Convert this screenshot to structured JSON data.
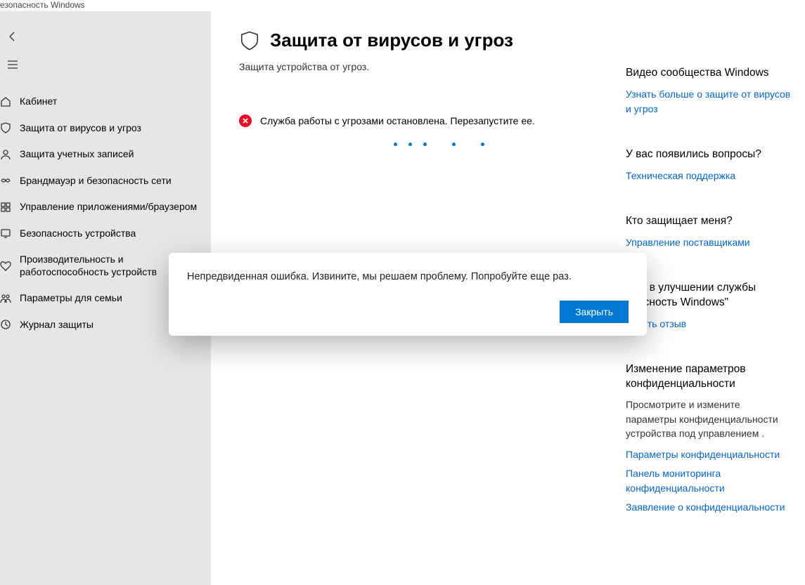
{
  "window": {
    "title_fragment": "езопасность Windows"
  },
  "sidebar": {
    "items": [
      {
        "label": "Кабинет"
      },
      {
        "label": "Защита от вирусов и угроз"
      },
      {
        "label": "Защита учетных записей"
      },
      {
        "label": "Брандмауэр и безопасность сети"
      },
      {
        "label": "Управление приложениями/браузером"
      },
      {
        "label": "Безопасность устройства"
      },
      {
        "label": "Производительность и работоспособность устройств"
      },
      {
        "label": "Параметры для семьи"
      },
      {
        "label": "Журнал защиты"
      }
    ]
  },
  "page": {
    "title": "Защита от вирусов и угроз",
    "subtitle": "Защита устройства от угроз.",
    "status_text": "Служба работы с угрозами остановлена. Перезапустите ее."
  },
  "right": {
    "s1_heading": "Видео сообщества Windows",
    "s1_link": "Узнать больше о защите от вирусов и угроз",
    "s2_heading": "У вас появились вопросы?",
    "s2_link": "Техническая поддержка",
    "s3_heading": "Кто защищает меня?",
    "s3_link": "Управление поставщиками",
    "s4_heading_part": "ощь в улучшении службы опасность Windows\"",
    "s4_link": "равить отзыв",
    "s5_heading": "Изменение параметров конфиденциальности",
    "s5_text": "Просмотрите и измените параметры конфиденциальности устройства под управлением .",
    "s5_link1": "Параметры конфиденциальности",
    "s5_link2": "Панель мониторинга конфиденциальности",
    "s5_link3": "Заявление о конфиденциальности"
  },
  "dialog": {
    "message": "Непредвиденная ошибка. Извините, мы решаем проблему. Попробуйте еще раз.",
    "close_label": "Закрыть"
  }
}
